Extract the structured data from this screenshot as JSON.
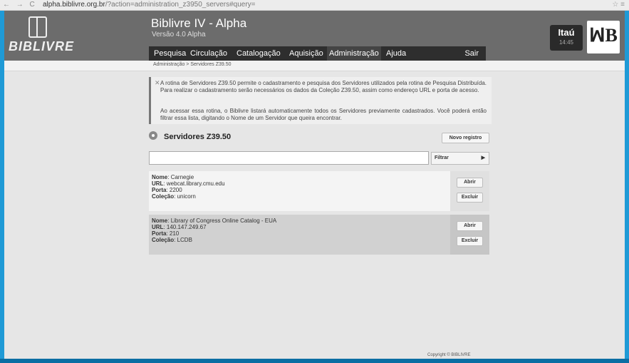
{
  "browser": {
    "nav_icons": "← → C",
    "url_host": "alpha.biblivre.org.br",
    "url_path": "/?action=administration_z3950_servers#query=",
    "right_icons": "☆ ≡"
  },
  "header": {
    "logo_text": "BIBLIVRE",
    "app_title": "Biblivre IV - Alpha",
    "version": "Versão 4.0 Alpha",
    "sponsor": "Itaú",
    "clock": "14:45",
    "emblem": "ꟽB"
  },
  "menu": {
    "items": [
      "Pesquisa",
      "Circulação",
      "Catalogação",
      "Aquisição",
      "Administração",
      "Ajuda"
    ],
    "logout": "Sair"
  },
  "breadcrumb": "Administração > Servidores Z39.50",
  "info": {
    "close": "✕",
    "paragraph1": "A rotina de Servidores Z39.50 permite o cadastramento e pesquisa dos Servidores utilizados pela rotina de Pesquisa Distribuída. Para realizar o cadastramento serão necessários os dados da Coleção Z39.50, assim como endereço URL e porta de acesso.",
    "paragraph2": "Ao acessar essa rotina, o Biblivre listará automaticamente todos os Servidores previamente cadastrados. Você poderá então filtrar essa lista, digitando o Nome de um Servidor que queira encontrar."
  },
  "section": {
    "title": "Servidores Z39.50",
    "new_button": "Novo registro",
    "search_value": "",
    "filter_label": "Filtrar",
    "filter_arrow": "▶"
  },
  "labels": {
    "name": "Nome",
    "url": "URL",
    "port": "Porta",
    "collection": "Coleção"
  },
  "records": [
    {
      "name": "Carnegie",
      "url": "webcat.library.cmu.edu",
      "port": "2200",
      "collection": "unicorn",
      "open": "Abrir",
      "delete": "Excluir"
    },
    {
      "name": "Library of Congress Online Catalog - EUA",
      "url": "140.147.249.67",
      "port": "210",
      "collection": "LCDB",
      "open": "Abrir",
      "delete": "Excluir"
    }
  ],
  "footer": "Copyright © BIBLIVRE"
}
